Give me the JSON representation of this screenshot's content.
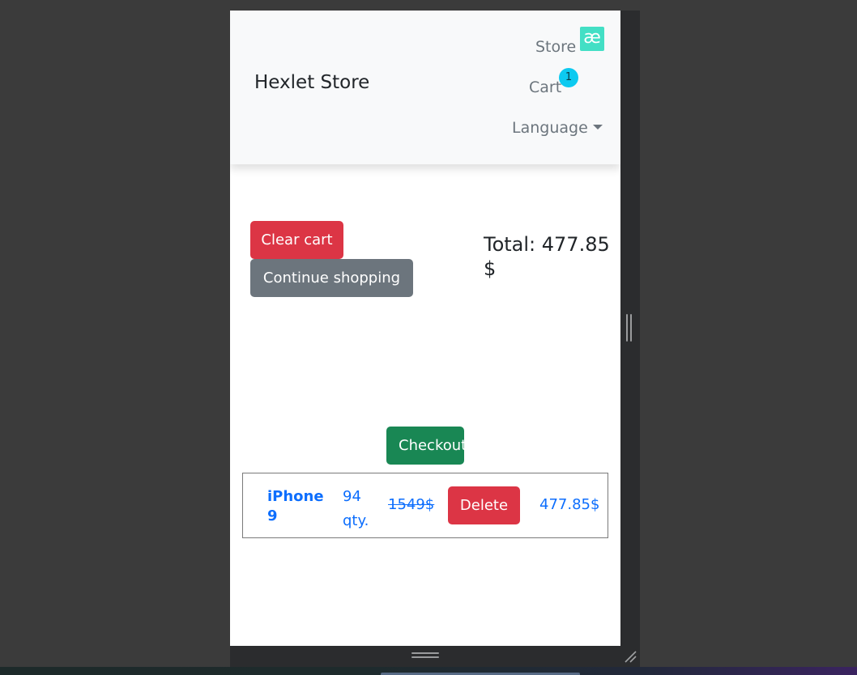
{
  "navbar": {
    "brand": "Hexlet Store",
    "links": {
      "store": "Store",
      "cart": "Cart",
      "language": "Language"
    },
    "cart_badge": "1",
    "extension_icon": {
      "name": "ae-ligature-icon",
      "glyph": "æ",
      "color": "#43dfc5"
    }
  },
  "cart": {
    "clear_label": "Clear cart",
    "continue_label": "Continue shopping",
    "total_label": "Total: 477.85 $",
    "checkout_label": "Checkout",
    "items": [
      {
        "name": "iPhone 9",
        "quantity": "94 qty.",
        "old_price": "1549$",
        "delete_label": "Delete",
        "price": "477.85$"
      }
    ]
  },
  "colors": {
    "danger": "#dc3545",
    "secondary": "#6c757d",
    "success": "#198754",
    "link": "#0d6efd",
    "badge": "#0dcaf0"
  }
}
